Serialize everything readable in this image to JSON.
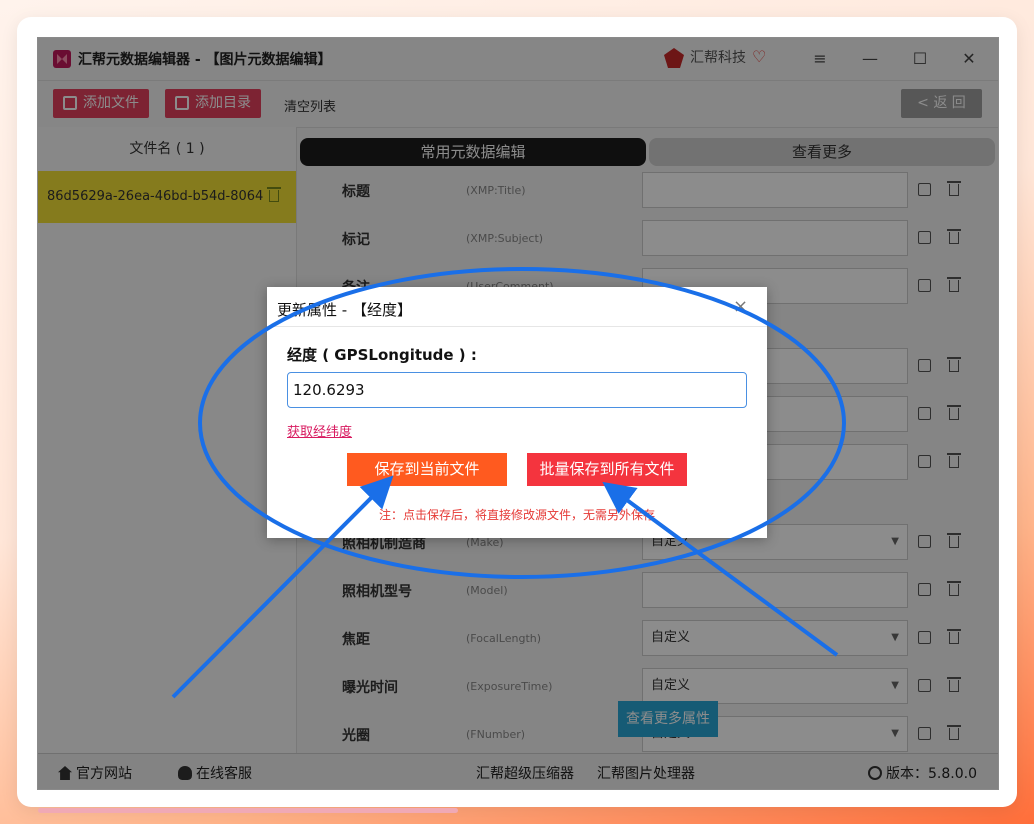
{
  "app": {
    "title": "汇帮元数据编辑器 - 【图片元数据编辑】",
    "brand": "汇帮科技",
    "window_controls": {
      "menu": "≡",
      "minimize": "—",
      "maximize": "☐",
      "close": "✕"
    }
  },
  "toolbar": {
    "add_file": "添加文件",
    "add_dir": "添加目录",
    "clear_list": "清空列表",
    "back": "< 返 回"
  },
  "file_list": {
    "header": "文件名 ( 1 )",
    "items": [
      {
        "name": "86d5629a-26ea-46bd-b54d-8064"
      }
    ]
  },
  "tabs": {
    "common": "常用元数据编辑",
    "more": "查看更多"
  },
  "fields": [
    {
      "label": "标题",
      "key": "(XMP:Title)",
      "value": ""
    },
    {
      "label": "标记",
      "key": "(XMP:Subject)",
      "value": ""
    },
    {
      "label": "备注",
      "key": "(UserComment)",
      "value": ""
    },
    {
      "label": "",
      "key": "",
      "value": ""
    },
    {
      "label": "",
      "key": "",
      "value": ""
    },
    {
      "label": "",
      "key": "",
      "value": ""
    },
    {
      "label": "照相机制造商",
      "key": "(Make)",
      "value": "自定义"
    },
    {
      "label": "照相机型号",
      "key": "(Model)",
      "value": ""
    },
    {
      "label": "焦距",
      "key": "(FocalLength)",
      "value": "自定义"
    },
    {
      "label": "曝光时间",
      "key": "(ExposureTime)",
      "value": "自定义"
    },
    {
      "label": "光圈",
      "key": "(FNumber)",
      "value": "自定义"
    }
  ],
  "more_attributes": "查看更多属性",
  "footer": {
    "website": "官方网站",
    "support": "在线客服",
    "compressor": "汇帮超级压缩器",
    "image_tool": "汇帮图片处理器",
    "version": "版本：5.8.0.0"
  },
  "dialog": {
    "title": "更新属性 - 【经度】",
    "field_label": "经度 ( GPSLongitude ) :",
    "value": "120.6293",
    "get_coords": "获取经纬度",
    "save_current": "保存到当前文件",
    "save_all": "批量保存到所有文件",
    "note": "注：点击保存后，将直接修改源文件，无需另外保存"
  },
  "colors": {
    "accent_pink": "#e3405e",
    "save_orange": "#ff5a1f",
    "batch_red": "#f4343e",
    "selected_row": "#f2e035",
    "annotation_blue": "#1a6fe8",
    "more_attr_blue": "#29a6d6"
  }
}
